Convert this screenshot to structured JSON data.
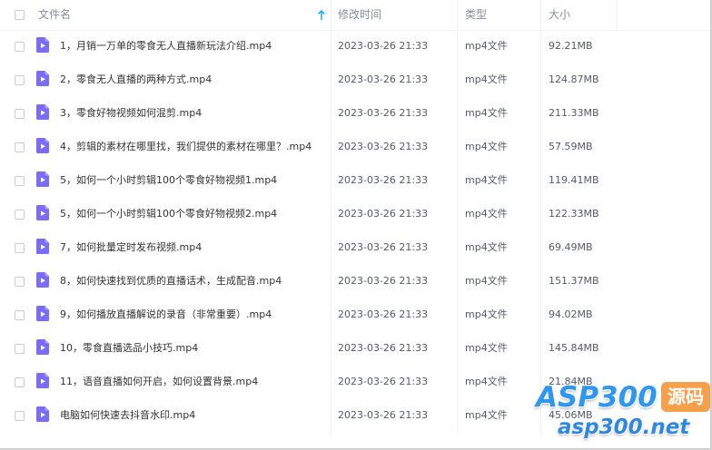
{
  "header": {
    "name_label": "文件名",
    "mtime_label": "修改时间",
    "type_label": "类型",
    "size_label": "大小",
    "sort_direction": "ascending"
  },
  "colors": {
    "accent": "#06a7ff",
    "file_icon": "#7b6cf6",
    "header_text": "#878c9c",
    "row_text": "#333333"
  },
  "files": [
    {
      "name": "1，月销一万单的零食无人直播新玩法介绍.mp4",
      "mtime": "2023-03-26 21:33",
      "type": "mp4文件",
      "size": "92.21MB",
      "icon": "video-file-icon"
    },
    {
      "name": "2，零食无人直播的两种方式.mp4",
      "mtime": "2023-03-26 21:33",
      "type": "mp4文件",
      "size": "124.87MB",
      "icon": "video-file-icon"
    },
    {
      "name": "3，零食好物视频如何混剪.mp4",
      "mtime": "2023-03-26 21:33",
      "type": "mp4文件",
      "size": "211.33MB",
      "icon": "video-file-icon"
    },
    {
      "name": "4，剪辑的素材在哪里找，我们提供的素材在哪里？.mp4",
      "mtime": "2023-03-26 21:33",
      "type": "mp4文件",
      "size": "57.59MB",
      "icon": "video-file-icon"
    },
    {
      "name": "5，如何一个小时剪辑100个零食好物视频1.mp4",
      "mtime": "2023-03-26 21:33",
      "type": "mp4文件",
      "size": "119.41MB",
      "icon": "video-file-icon"
    },
    {
      "name": "5，如何一个小时剪辑100个零食好物视频2.mp4",
      "mtime": "2023-03-26 21:33",
      "type": "mp4文件",
      "size": "122.33MB",
      "icon": "video-file-icon"
    },
    {
      "name": "7，如何批量定时发布视频.mp4",
      "mtime": "2023-03-26 21:33",
      "type": "mp4文件",
      "size": "69.49MB",
      "icon": "video-file-icon"
    },
    {
      "name": "8，如何快速找到优质的直播话术，生成配音.mp4",
      "mtime": "2023-03-26 21:33",
      "type": "mp4文件",
      "size": "151.37MB",
      "icon": "video-file-icon"
    },
    {
      "name": "9，如何播放直播解说的录音（非常重要）.mp4",
      "mtime": "2023-03-26 21:33",
      "type": "mp4文件",
      "size": "94.02MB",
      "icon": "video-file-icon"
    },
    {
      "name": "10，零食直播选品小技巧.mp4",
      "mtime": "2023-03-26 21:33",
      "type": "mp4文件",
      "size": "145.84MB",
      "icon": "video-file-icon"
    },
    {
      "name": "11，语音直播如何开启，如何设置背景.mp4",
      "mtime": "2023-03-26 21:33",
      "type": "mp4文件",
      "size": "21.84MB",
      "icon": "video-file-icon"
    },
    {
      "name": "电脑如何快速去抖音水印.mp4",
      "mtime": "2023-03-26 21:33",
      "type": "mp4文件",
      "size": "45.06MB",
      "icon": "video-file-icon"
    }
  ],
  "watermark": {
    "brand": "ASP300",
    "badge": "源码",
    "url": "asp300.net"
  }
}
